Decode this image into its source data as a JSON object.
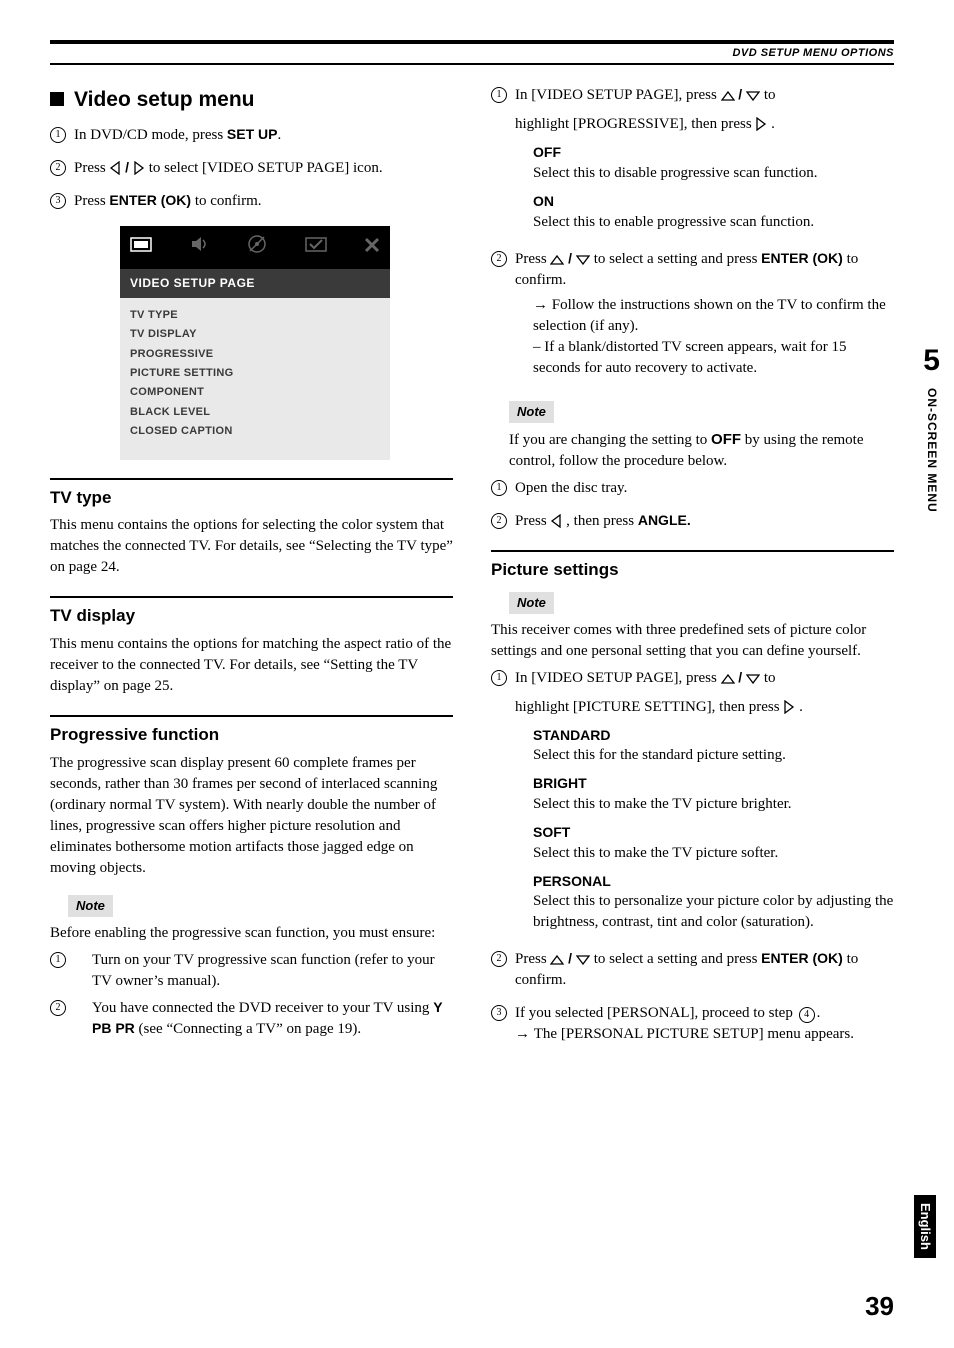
{
  "header": {
    "section": "DVD SETUP MENU OPTIONS"
  },
  "side": {
    "chapter_no": "5",
    "chapter_title": "ON-SCREEN MENU",
    "lang": "English"
  },
  "page_number": "39",
  "left": {
    "main_heading": "Video setup menu",
    "steps": [
      {
        "n": "1",
        "pre": "In DVD/CD mode, press ",
        "bold": "SET UP",
        "post": "."
      },
      {
        "n": "2",
        "pre": "Press ",
        "mid": " to select [VIDEO SETUP PAGE] icon."
      },
      {
        "n": "3",
        "pre": "Press ",
        "bold": "ENTER (OK)",
        "post": " to confirm."
      }
    ],
    "menu": {
      "title": "VIDEO SETUP PAGE",
      "items": [
        "TV TYPE",
        "TV DISPLAY",
        "PROGRESSIVE",
        "PICTURE SETTING",
        "COMPONENT",
        "BLACK LEVEL",
        "CLOSED CAPTION"
      ]
    },
    "tvtype": {
      "title": "TV type",
      "body": "This menu contains the options for selecting the color system that matches the connected TV. For details, see “Selecting the TV type” on page 24."
    },
    "tvdisplay": {
      "title": "TV display",
      "body": "This menu contains the options for matching the aspect ratio of the receiver to the connected TV. For details, see “Setting the TV display” on page 25."
    },
    "prog": {
      "title": "Progressive function",
      "body": "The progressive scan display present 60 complete frames per seconds, rather than 30 frames per second of interlaced scanning (ordinary normal TV system). With nearly double the number of lines, progressive scan offers higher picture resolution and eliminates bothersome motion artifacts those jagged edge on moving objects.",
      "note": "Note",
      "ensure": "Before enabling the progressive scan function, you must ensure:",
      "e1": "Turn on your TV progressive scan function (refer to your TV owner’s manual).",
      "e2_pre": "You have connected the DVD receiver to your TV using ",
      "e2_bold": "Y PB PR",
      "e2_post": " (see “Connecting a TV” on page 19)."
    }
  },
  "right": {
    "s1_pre": "In [VIDEO SETUP PAGE], press ",
    "s1_post": " to",
    "s1_line2_pre": "highlight [PROGRESSIVE], then press ",
    "s1_line2_post": ".",
    "off_t": "OFF",
    "off_d": "Select this to disable progressive scan function.",
    "on_t": "ON",
    "on_d": "Select this to enable progressive scan function.",
    "s2_pre": "Press ",
    "s2_mid": " to select a setting and press ",
    "s2_bold": "ENTER (OK)",
    "s2_post": " to confirm.",
    "s2_a": "Follow the instructions shown on the TV to confirm the selection (if any).",
    "s2_b": "– If a blank/distorted TV screen appears, wait for 15 seconds for auto recovery to activate.",
    "note": "Note",
    "note_body_pre": "If you are changing the setting to ",
    "note_body_bold": "OFF",
    "note_body_post": " by using the remote control, follow the procedure below.",
    "n1": "Open the disc tray.",
    "n2_pre": "Press ",
    "n2_mid": ", then press ",
    "n2_bold": "ANGLE.",
    "pic": {
      "title": "Picture settings",
      "note": "Note",
      "intro": "This receiver comes with three predefined sets of picture color settings and one personal setting that you can define yourself.",
      "s1_pre": "In [VIDEO SETUP PAGE], press ",
      "s1_post": " to",
      "s1_l2_pre": "highlight [PICTURE SETTING], then press ",
      "s1_l2_post": ".",
      "std_t": "STANDARD",
      "std_d": "Select this for the standard picture setting.",
      "bri_t": "BRIGHT",
      "bri_d": "Select this to make the TV picture brighter.",
      "sof_t": "SOFT",
      "sof_d": "Select this to make the TV picture softer.",
      "per_t": "PERSONAL",
      "per_d": "Select this to personalize your picture color by adjusting the brightness, contrast, tint and color (saturation).",
      "s2_pre": "Press ",
      "s2_mid": " to select a setting and press ",
      "s2_bold": "ENTER (OK)",
      "s2_post": " to confirm.",
      "s3_pre": "If you selected [PERSONAL], proceed to step ",
      "s3_circ": "4",
      "s3_post": ".",
      "s3_arrow": "The [PERSONAL PICTURE SETUP] menu appears."
    }
  }
}
